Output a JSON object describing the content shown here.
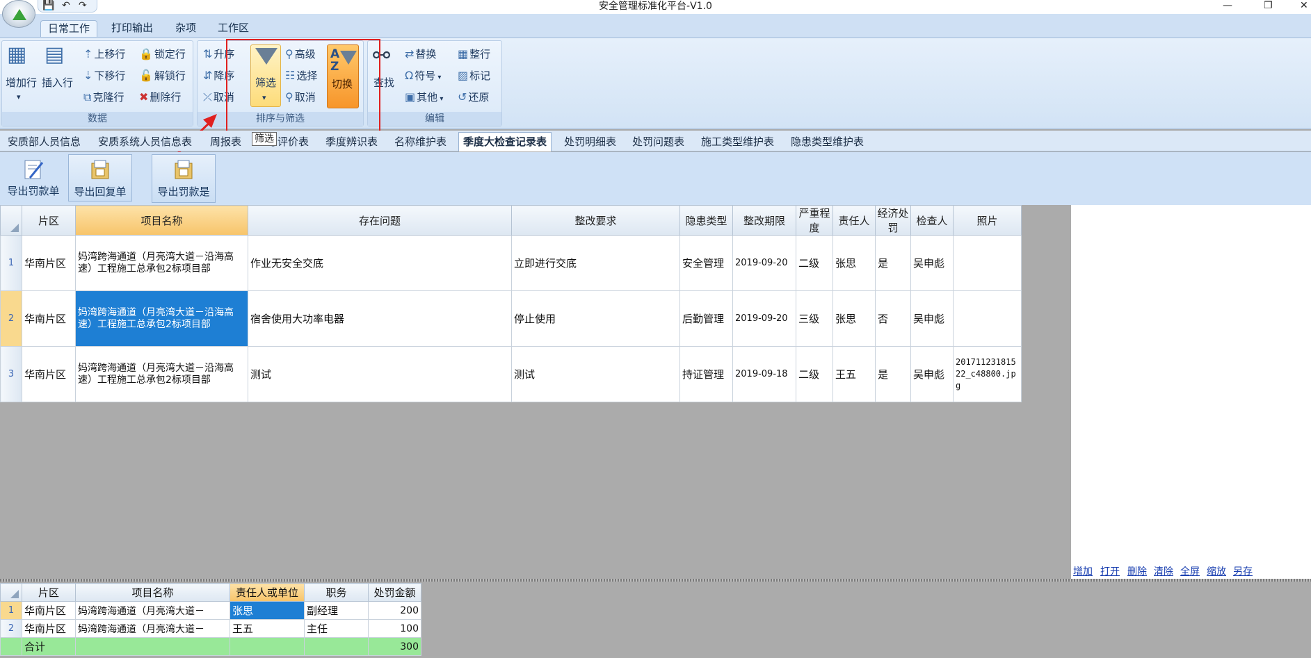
{
  "window": {
    "title": "安全管理标准化平台-V1.0",
    "minimize": "—",
    "restore": "❐",
    "close": "✕"
  },
  "qat": {
    "save": "💾",
    "undo": "↶",
    "redo": "↷"
  },
  "ribbon_tabs": [
    "日常工作",
    "打印输出",
    "杂项",
    "工作区"
  ],
  "groups": {
    "data": {
      "caption": "数据",
      "add_row": "增加行",
      "insert_row": "插入行",
      "move_up": "上移行",
      "move_down": "下移行",
      "clone_row": "克隆行",
      "lock_row": "锁定行",
      "unlock_row": "解锁行",
      "delete_row": "删除行"
    },
    "sort": {
      "caption": "排序与筛选",
      "asc": "升序",
      "desc": "降序",
      "cancel_sort": "取消",
      "filter": "筛选",
      "advanced": "高级",
      "select": "选择",
      "cancel_filter": "取消",
      "switch": "切换"
    },
    "edit": {
      "caption": "编辑",
      "find": "查找",
      "replace": "替换",
      "symbol": "符号",
      "other": "其他",
      "tidy": "整行",
      "mark": "标记",
      "restore": "还原"
    }
  },
  "tooltip": "筛选",
  "sheet_tabs": [
    "安质部人员信息",
    "安质系统人员信息表",
    "周报表",
    "考评价表",
    "季度辨识表",
    "名称维护表",
    "季度大检查记录表",
    "处罚明细表",
    "处罚问题表",
    "施工类型维护表",
    "隐患类型维护表"
  ],
  "toolbar": {
    "export_fine": "导出罚款单",
    "export_reply": "导出回复单",
    "export_fine2": "导出罚款是"
  },
  "main_grid": {
    "headers": [
      "片区",
      "项目名称",
      "存在问题",
      "整改要求",
      "隐患类型",
      "整改期限",
      "严重程度",
      "责任人",
      "经济处罚",
      "检查人",
      "照片"
    ],
    "rows": [
      {
        "no": "1",
        "area": "华南片区",
        "project": "妈湾跨海通道（月亮湾大道－沿海高速）工程施工总承包2标项目部",
        "issue": "作业无安全交底",
        "req": "立即进行交底",
        "type": "安全管理",
        "deadline": "2019-09-20",
        "level": "二级",
        "person": "张思",
        "fine": "是",
        "inspector": "吴申彪",
        "photo": ""
      },
      {
        "no": "2",
        "area": "华南片区",
        "project": "妈湾跨海通道（月亮湾大道－沿海高速）工程施工总承包2标项目部",
        "issue": "宿舍使用大功率电器",
        "req": "停止使用",
        "type": "后勤管理",
        "deadline": "2019-09-20",
        "level": "三级",
        "person": "张思",
        "fine": "否",
        "inspector": "吴申彪",
        "photo": ""
      },
      {
        "no": "3",
        "area": "华南片区",
        "project": "妈湾跨海通道（月亮湾大道－沿海高速）工程施工总承包2标项目部",
        "issue": "测试",
        "req": "测试",
        "type": "持证管理",
        "deadline": "2019-09-18",
        "level": "二级",
        "person": "王五",
        "fine": "是",
        "inspector": "吴申彪",
        "photo": "20171123181522_c48800.jpg"
      }
    ]
  },
  "panel_links": [
    "增加",
    "打开",
    "删除",
    "清除",
    "全屏",
    "缩放",
    "另存"
  ],
  "sub_grid": {
    "headers": [
      "片区",
      "项目名称",
      "责任人或单位",
      "职务",
      "处罚金额"
    ],
    "rows": [
      {
        "no": "1",
        "area": "华南片区",
        "project": "妈湾跨海通道（月亮湾大道－",
        "person": "张思",
        "title": "副经理",
        "amount": "200"
      },
      {
        "no": "2",
        "area": "华南片区",
        "project": "妈湾跨海通道（月亮湾大道－",
        "person": "王五",
        "title": "主任",
        "amount": "100"
      }
    ],
    "total_label": "合计",
    "total_amount": "300"
  }
}
